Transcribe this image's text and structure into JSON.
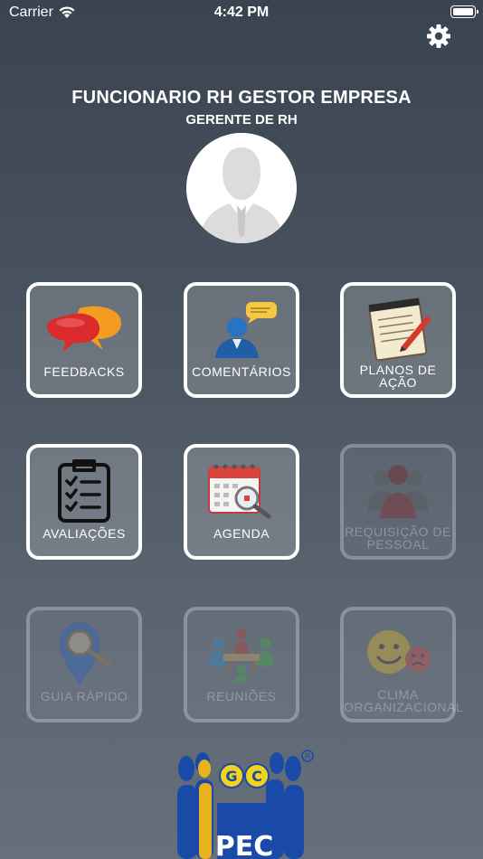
{
  "status_bar": {
    "carrier": "Carrier",
    "time": "4:42 PM"
  },
  "profile": {
    "name": "FUNCIONARIO RH GESTOR EMPRESA",
    "role": "GERENTE DE RH"
  },
  "menu": [
    {
      "label": "FEEDBACKS",
      "icon": "speech-bubbles-icon",
      "enabled": true
    },
    {
      "label": "COMENTÁRIOS",
      "icon": "person-comment-icon",
      "enabled": true
    },
    {
      "label_lines": [
        "PLANOS DE",
        "AÇÃO"
      ],
      "icon": "notepad-pencil-icon",
      "enabled": true
    },
    {
      "label": "AVALIAÇÕES",
      "icon": "clipboard-checklist-icon",
      "enabled": true
    },
    {
      "label": "AGENDA",
      "icon": "calendar-magnifier-icon",
      "enabled": true
    },
    {
      "label_lines": [
        "REQUISIÇÃO DE",
        "PESSOAL"
      ],
      "icon": "people-group-icon",
      "enabled": false
    },
    {
      "label": "GUIA RÁPIDO",
      "icon": "map-pin-magnifier-icon",
      "enabled": false
    },
    {
      "label": "REUNIÕES",
      "icon": "meeting-table-icon",
      "enabled": false
    },
    {
      "label_lines": [
        "CLIMA",
        "ORGANIZACIONAL"
      ],
      "icon": "smiley-faces-icon",
      "enabled": false
    }
  ],
  "logo": {
    "letters_top": "GC",
    "letters_bottom": "PEC",
    "mark": "®"
  }
}
